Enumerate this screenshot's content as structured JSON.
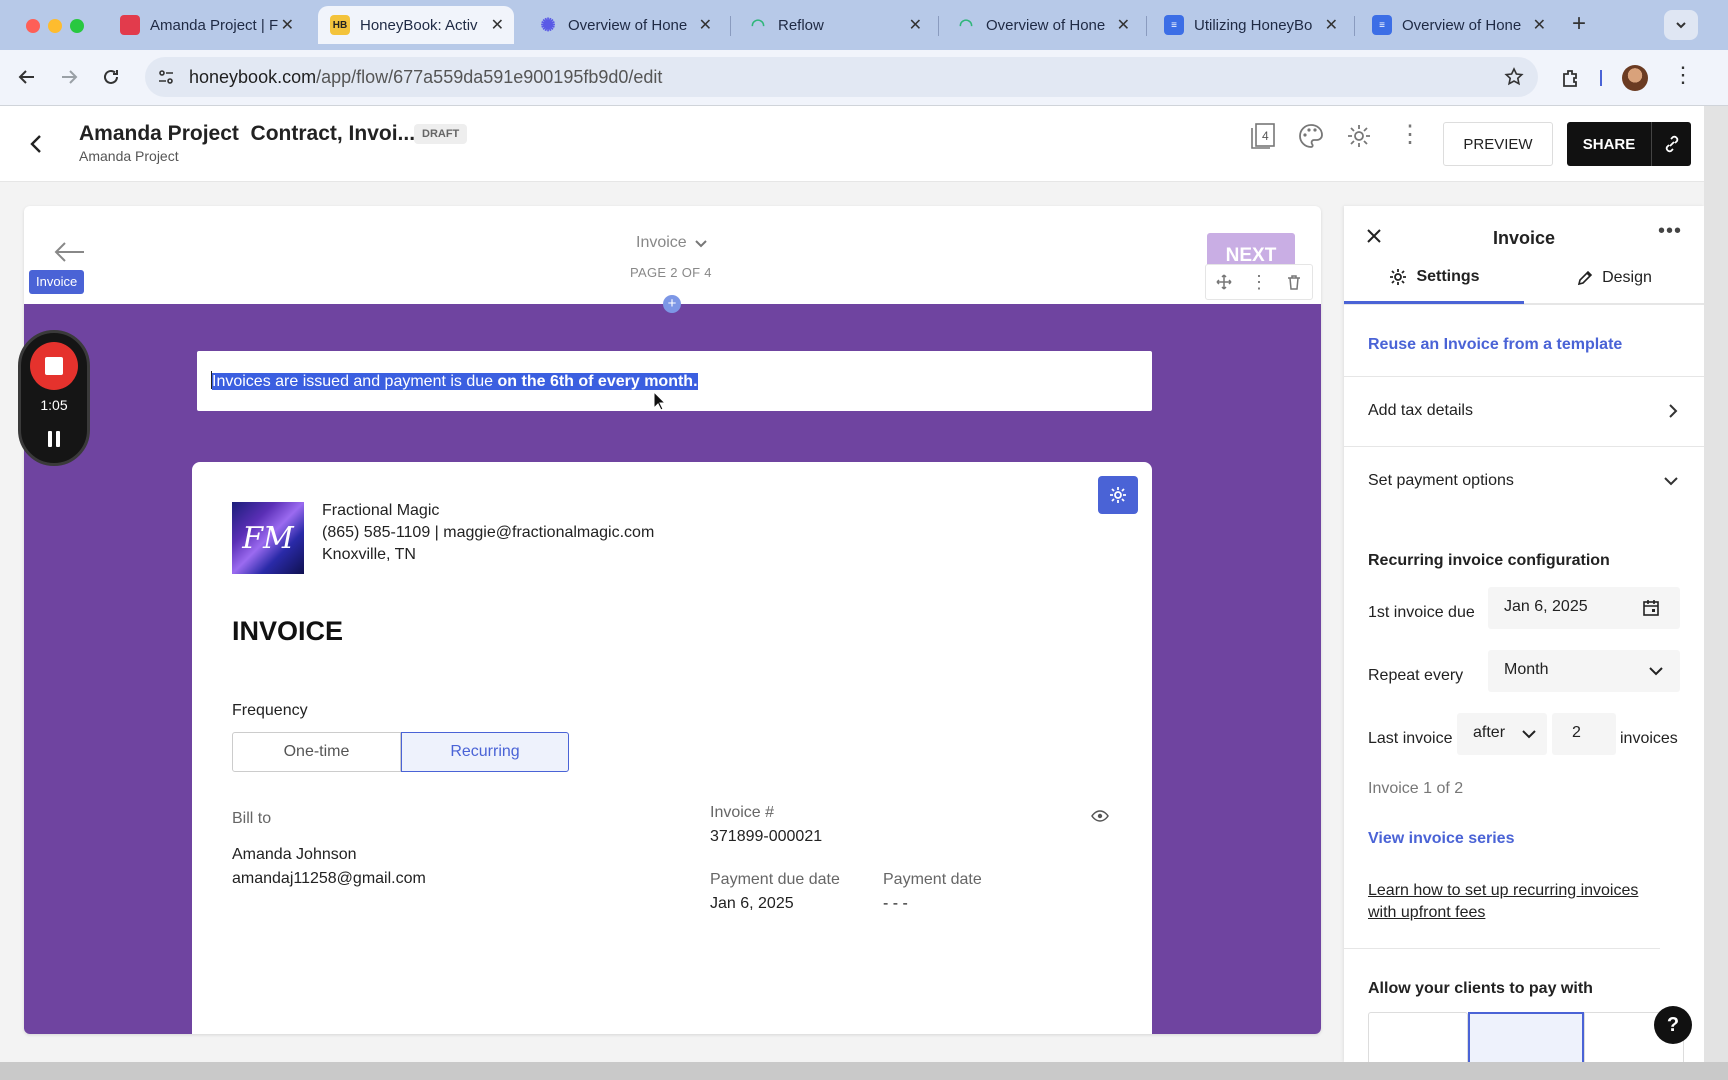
{
  "browser": {
    "tabs": [
      {
        "title": "Amanda Project | F",
        "favicon_color": "#e23b4c"
      },
      {
        "title": "HoneyBook: Activ",
        "favicon_color": "#f3c33c",
        "favicon_text": "HB"
      },
      {
        "title": "Overview of Hone",
        "favicon_color": "#5a5ae6"
      },
      {
        "title": "Reflow",
        "favicon_color": "#2fb67a"
      },
      {
        "title": "Overview of Hone",
        "favicon_color": "#2fb67a"
      },
      {
        "title": "Utilizing HoneyBo",
        "favicon_color": "#3c6ee6"
      },
      {
        "title": "Overview of Hone",
        "favicon_color": "#3c6ee6"
      }
    ],
    "url_domain": "honeybook.com",
    "url_path": "/app/flow/677a559da591e900195fb9d0/edit"
  },
  "header": {
    "title": "Amanda Project  Contract, Invoi...",
    "status_badge": "DRAFT",
    "subtitle": "Amanda Project",
    "pages_count": "4",
    "preview_label": "PREVIEW",
    "share_label": "SHARE"
  },
  "editor": {
    "section_label": "Invoice",
    "page_selector": "Invoice",
    "page_indicator": "PAGE 2 OF 4",
    "next_label": "NEXT",
    "note_text_plain": "Invoices are issued and payment is due ",
    "note_text_bold": "on the 6th of every month."
  },
  "recorder": {
    "time": "1:05"
  },
  "invoice": {
    "company_name": "Fractional Magic",
    "company_contact": "(865) 585-1109 | maggie@fractionalmagic.com",
    "company_location": "Knoxville, TN",
    "logo_text": "FM",
    "heading": "INVOICE",
    "frequency_label": "Frequency",
    "freq_one_time": "One-time",
    "freq_recurring": "Recurring",
    "bill_to_label": "Bill to",
    "client_name": "Amanda Johnson",
    "client_email": "amandaj11258@gmail.com",
    "invoice_number_label": "Invoice #",
    "invoice_number": "371899-000021",
    "due_date_label": "Payment due date",
    "due_date": "Jan 6, 2025",
    "payment_date_label": "Payment date",
    "payment_date": "- - -"
  },
  "panel": {
    "title": "Invoice",
    "tab_settings": "Settings",
    "tab_design": "Design",
    "reuse_link": "Reuse an Invoice from a template",
    "tax_label": "Add tax details",
    "payment_options_label": "Set payment options",
    "recurring_heading": "Recurring invoice configuration",
    "first_due_label": "1st invoice due",
    "first_due_value": "Jan 6, 2025",
    "repeat_label": "Repeat every",
    "repeat_value": "Month",
    "last_invoice_label": "Last invoice",
    "last_invoice_mode": "after",
    "last_invoice_count": "2",
    "last_invoice_suffix": "invoices",
    "series_info": "Invoice 1 of 2",
    "view_series_link": "View invoice series",
    "learn_link": "Learn how to set up recurring invoices with upfront fees",
    "allow_pay_heading": "Allow your clients to pay with",
    "help_label": "?"
  },
  "colors": {
    "accent": "#4a63d6",
    "purple": "#6f44a0",
    "highlight": "#3b5fe0"
  }
}
